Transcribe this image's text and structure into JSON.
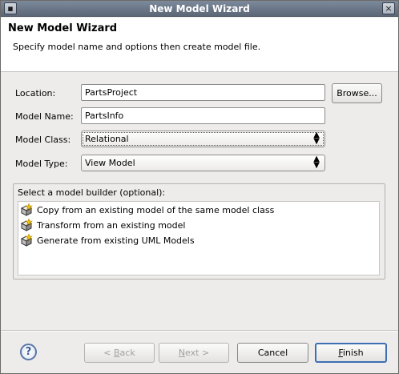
{
  "window": {
    "title": "New Model Wizard"
  },
  "header": {
    "title": "New Model Wizard",
    "description": "Specify model name and options then create model file."
  },
  "form": {
    "location_label": "Location:",
    "location_value": "PartsProject",
    "browse_label": "Browse...",
    "model_name_label": "Model Name:",
    "model_name_value": "PartsInfo",
    "model_class_label": "Model Class:",
    "model_class_value": "Relational",
    "model_type_label": "Model Type:",
    "model_type_value": "View Model"
  },
  "builder": {
    "group_label": "Select a model builder (optional):",
    "items": [
      {
        "label": "Copy from an existing model of the same model class",
        "icon": "model-builder-icon"
      },
      {
        "label": "Transform from an existing model",
        "icon": "model-builder-icon"
      },
      {
        "label": "Generate from existing UML Models",
        "icon": "model-builder-icon"
      }
    ]
  },
  "footer": {
    "help_icon": "help-icon",
    "back_prefix": "< ",
    "back_mnemonic": "B",
    "back_rest": "ack",
    "next_mnemonic": "N",
    "next_rest": "ext >",
    "cancel_label": "Cancel",
    "finish_mnemonic": "F",
    "finish_rest": "inish"
  },
  "colors": {
    "titlebar": "#6b7788",
    "default_button_border": "#3d6fb3",
    "window_bg": "#edeceb"
  }
}
